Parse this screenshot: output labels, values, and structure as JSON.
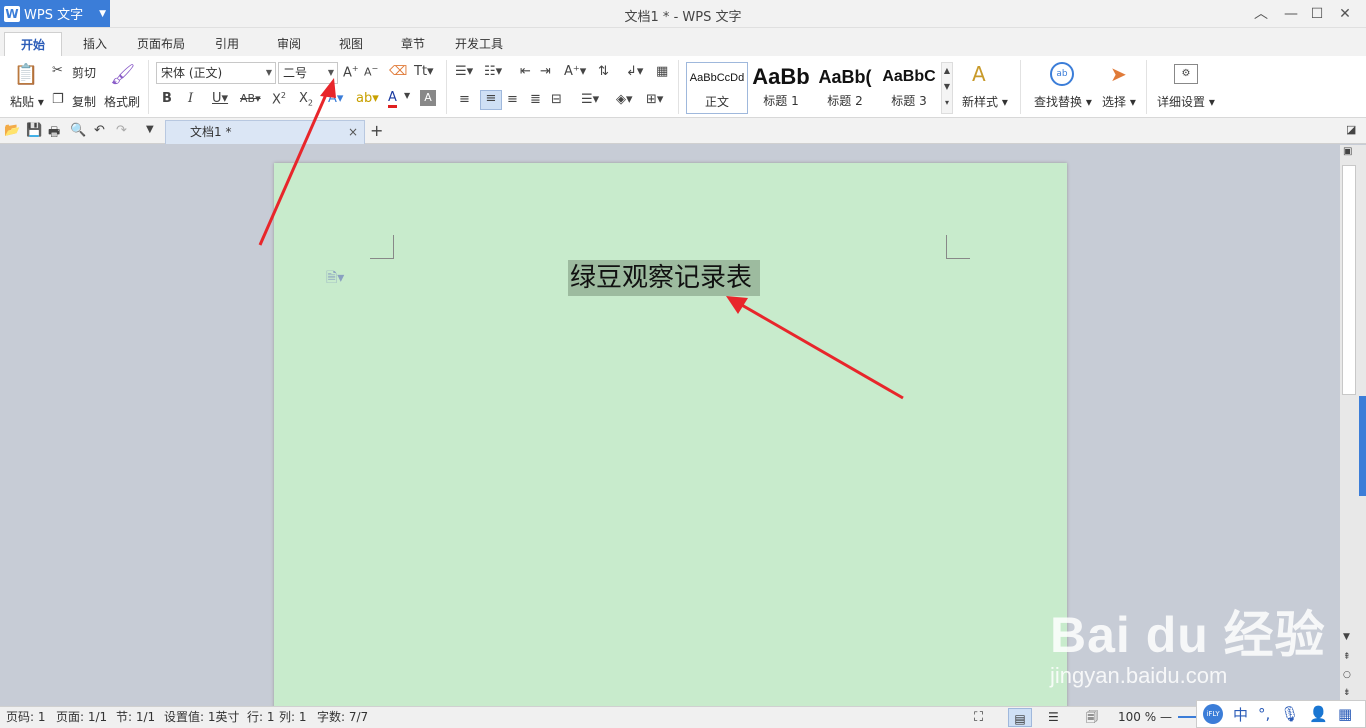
{
  "app": {
    "name": "WPS 文字",
    "window_title": "文档1 * - WPS 文字"
  },
  "menu_tabs": [
    "开始",
    "插入",
    "页面布局",
    "引用",
    "审阅",
    "视图",
    "章节",
    "开发工具"
  ],
  "clipboard": {
    "paste": "粘贴",
    "cut": "剪切",
    "copy": "复制",
    "format_painter": "格式刷"
  },
  "font": {
    "family": "宋体 (正文)",
    "size": "二号"
  },
  "styles": [
    {
      "preview": "AaBbCcDd",
      "name": "正文"
    },
    {
      "preview": "AaBb",
      "name": "标题 1"
    },
    {
      "preview": "AaBb(",
      "name": "标题 2"
    },
    {
      "preview": "AaBbC",
      "name": "标题 3"
    }
  ],
  "ribbon_right": {
    "new_style": "新样式",
    "find_replace": "查找替换",
    "select": "选择",
    "detail_settings": "详细设置"
  },
  "doc_tab": {
    "label": "文档1 *"
  },
  "document": {
    "title_text": "绿豆观察记录表"
  },
  "status": {
    "page": "页码: 1",
    "pages": "页面: 1/1",
    "section": "节: 1/1",
    "setting": "设置值: 1英寸",
    "row": "行: 1",
    "col": "列: 1",
    "words": "字数: 7/7",
    "zoom": "100 %"
  },
  "watermark": {
    "brand": "Bai du 经验",
    "url": "jingyan.baidu.com"
  },
  "ime": {
    "mode": "中"
  },
  "colors": {
    "accent": "#3b7dd8",
    "page": "#c8ebcc",
    "selection": "#9dbb9f",
    "arrow": "#e8262b"
  }
}
